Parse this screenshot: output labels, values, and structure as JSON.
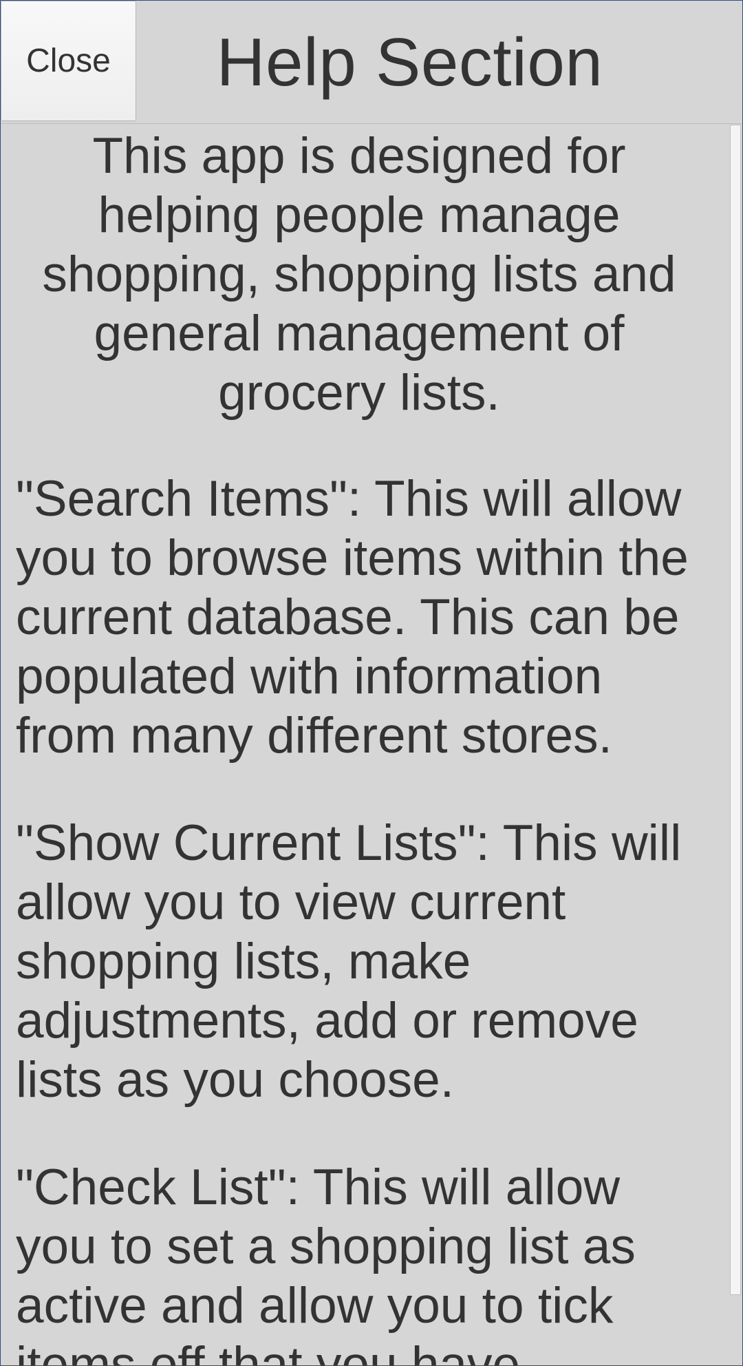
{
  "header": {
    "close_label": "Close",
    "title": "Help Section"
  },
  "content": {
    "intro": "This app is designed for helping people manage shopping, shopping lists and general management of grocery lists.",
    "paragraphs": [
      "\"Search Items\": This will allow you to browse items within the current database. This can be populated with information from many different stores.",
      "\"Show Current Lists\": This will allow you to view current shopping lists, make adjustments, add or remove lists as you choose.",
      "\"Check List\": This will allow you to set a shopping list as active and allow you to tick items off that you have"
    ]
  },
  "colors": {
    "background": "#d6d6d6",
    "text": "#333333",
    "frame_border": "#3b4a66",
    "button_bg": "#f4f4f4"
  }
}
